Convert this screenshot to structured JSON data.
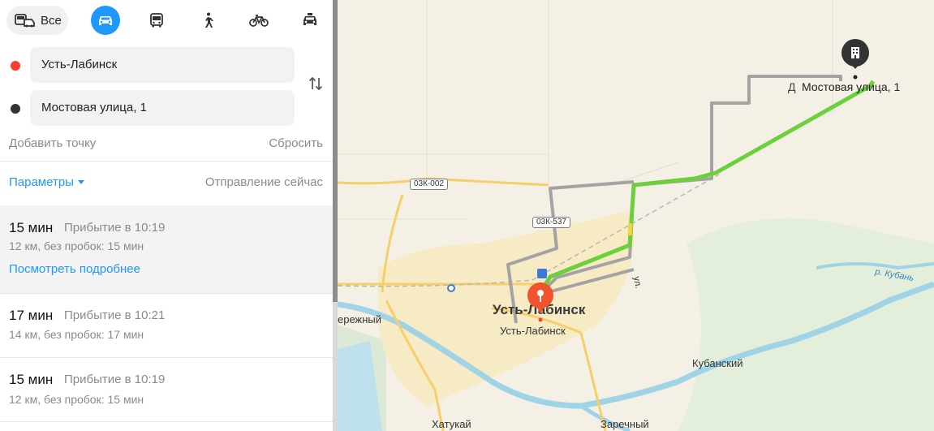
{
  "modes": {
    "all_label": "Все",
    "items": [
      {
        "name": "car-mode-button",
        "icon": "car-icon",
        "active": true
      },
      {
        "name": "transit-mode-button",
        "icon": "bus-icon",
        "active": false
      },
      {
        "name": "walk-mode-button",
        "icon": "pedestrian-icon",
        "active": false
      },
      {
        "name": "bike-mode-button",
        "icon": "bicycle-icon",
        "active": false
      },
      {
        "name": "taxi-mode-button",
        "icon": "taxi-icon",
        "active": false
      }
    ]
  },
  "route_form": {
    "from": "Усть-Лабинск",
    "to": "Мостовая улица, 1",
    "add_point": "Добавить точку",
    "reset": "Сбросить",
    "from_color": "#f33",
    "to_color": "#333333"
  },
  "options": {
    "params_label": "Параметры",
    "departure_label": "Отправление сейчас"
  },
  "routes": [
    {
      "time": "15 мин",
      "arrival": "Прибытие в 10:19",
      "info": "12 км, без пробок: 15 мин",
      "details_link": "Посмотреть подробнее",
      "selected": true
    },
    {
      "time": "17 мин",
      "arrival": "Прибытие в 10:21",
      "info": "14 км, без пробок: 17 мин",
      "selected": false
    },
    {
      "time": "15 мин",
      "arrival": "Прибытие в 10:19",
      "info": "12 км, без пробок: 15 мин",
      "selected": false
    }
  ],
  "map": {
    "destination_label": "Мостовая улица, 1",
    "destination_prefix": "Д",
    "start_label": "Усть-Лабинск",
    "city_label": "Усть-Лабинск",
    "place_labels": {
      "berezhny": "ережный",
      "kubansky": "Кубанский",
      "khatukay": "Хатукай",
      "zarechny": "Заречный",
      "kuban_river": "р. Кубань",
      "street_fragment": "ул."
    },
    "road_badges": {
      "r1": "03К-002",
      "r2": "03К-537"
    },
    "route_color": "#6ccf3c",
    "alt_route_color": "#a3a3a3",
    "water_color": "#9fd3e6"
  }
}
